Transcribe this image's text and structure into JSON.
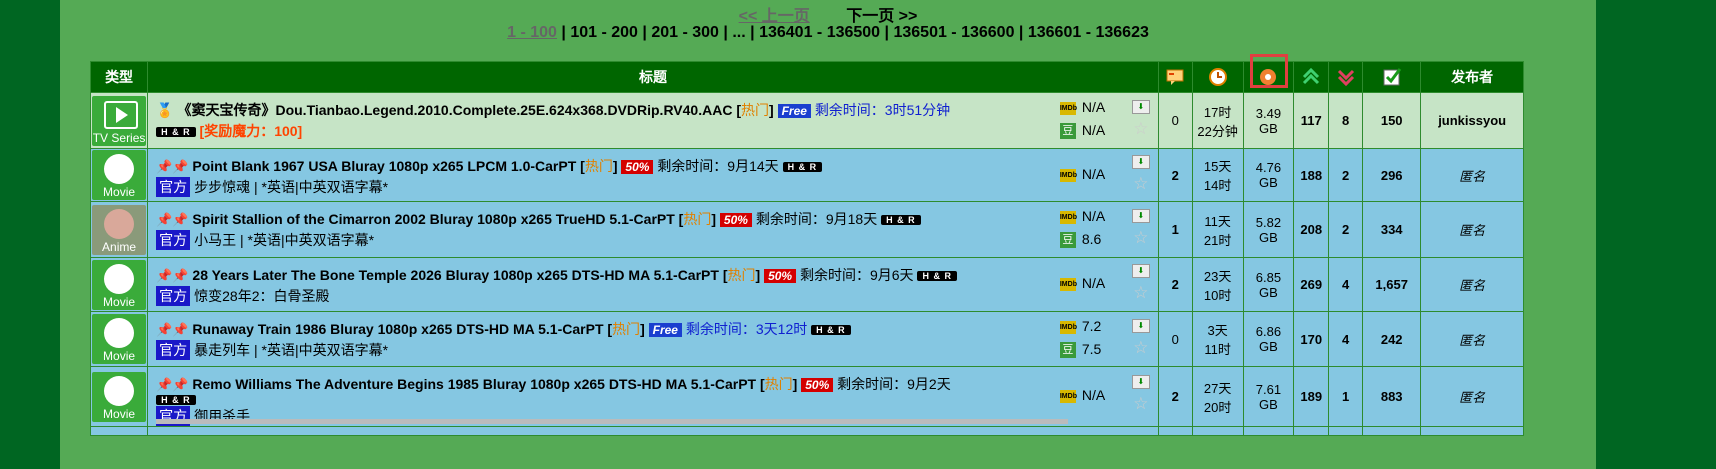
{
  "pager": {
    "prev": "<< 上一页",
    "next": "下一页 >>",
    "ranges": [
      "1 - 100",
      "101 - 200",
      "201 - 300",
      "...",
      "136401 - 136500",
      "136501 - 136600",
      "136601 - 136623"
    ],
    "sep": "|"
  },
  "headers": {
    "type": "类型",
    "title": "标题",
    "uploader": "发布者"
  },
  "rows": [
    {
      "category": "TV Series",
      "title": "《窦天宝传奇》Dou.Tianbao.Legend.2010.Complete.25E.624x368.DVDRip.RV40.AAC",
      "hot": "热门",
      "promo": "Free",
      "remaining": "剩余时间：3时51分钟",
      "tag": "H & R",
      "bonus": "[奖励魔力：100]",
      "imdb": "N/A",
      "douban": "N/A",
      "comments": "0",
      "time1": "17时",
      "time2": "22分钟",
      "size1": "3.49",
      "size2": "GB",
      "seeders": "117",
      "leechers": "8",
      "completed": "150",
      "uploader": "junkissyou"
    },
    {
      "category": "Movie",
      "title": "Point Blank 1967 USA Bluray 1080p x265 LPCM 1.0-CarPT",
      "hot": "热门",
      "promo": "50%",
      "remaining": "剩余时间：9月14天",
      "tag": "H & R",
      "official": "官方",
      "subtitle": "步步惊魂 | *英语|中英双语字幕*",
      "imdb": "N/A",
      "comments": "2",
      "time1": "15天",
      "time2": "14时",
      "size1": "4.76",
      "size2": "GB",
      "seeders": "188",
      "leechers": "2",
      "completed": "296",
      "uploader": "匿名"
    },
    {
      "category": "Anime",
      "title": "Spirit Stallion of the Cimarron 2002 Bluray 1080p x265 TrueHD 5.1-CarPT",
      "hot": "热门",
      "promo": "50%",
      "remaining": "剩余时间：9月18天",
      "tag": "H & R",
      "official": "官方",
      "subtitle": "小马王 | *英语|中英双语字幕*",
      "imdb": "N/A",
      "douban": "8.6",
      "comments": "1",
      "time1": "11天",
      "time2": "21时",
      "size1": "5.82",
      "size2": "GB",
      "seeders": "208",
      "leechers": "2",
      "completed": "334",
      "uploader": "匿名"
    },
    {
      "category": "Movie",
      "title": "28 Years Later The Bone Temple 2026 Bluray 1080p x265 DTS-HD MA 5.1-CarPT",
      "hot": "热门",
      "promo": "50%",
      "remaining": "剩余时间：9月6天",
      "tag": "H & R",
      "official": "官方",
      "subtitle": "惊变28年2：白骨圣殿",
      "imdb": "N/A",
      "comments": "2",
      "time1": "23天",
      "time2": "10时",
      "size1": "6.85",
      "size2": "GB",
      "seeders": "269",
      "leechers": "4",
      "completed": "1,657",
      "uploader": "匿名"
    },
    {
      "category": "Movie",
      "title": "Runaway Train 1986 Bluray 1080p x265 DTS-HD MA 5.1-CarPT",
      "hot": "热门",
      "promo": "Free",
      "remaining": "剩余时间：3天12时",
      "tag": "H & R",
      "official": "官方",
      "subtitle": "暴走列车 | *英语|中英双语字幕*",
      "imdb": "7.2",
      "douban": "7.5",
      "comments": "0",
      "time1": "3天",
      "time2": "11时",
      "size1": "6.86",
      "size2": "GB",
      "seeders": "170",
      "leechers": "4",
      "completed": "242",
      "uploader": "匿名"
    },
    {
      "category": "Movie",
      "title": "Remo Williams The Adventure Begins 1985 Bluray 1080p x265 DTS-HD MA 5.1-CarPT",
      "hot": "热门",
      "promo": "50%",
      "remaining": "剩余时间：9月2天",
      "tag": "H & R",
      "official": "官方",
      "subtitle": "御用杀手",
      "imdb": "N/A",
      "comments": "2",
      "time1": "27天",
      "time2": "20时",
      "size1": "7.61",
      "size2": "GB",
      "seeders": "189",
      "leechers": "1",
      "completed": "883",
      "uploader": "匿名"
    }
  ],
  "icons": {
    "comments": "comment-icon",
    "time": "clock-icon",
    "size": "disc-icon",
    "seeders": "up-arrow-icon",
    "leechers": "down-arrow-icon",
    "completed": "check-icon"
  },
  "colors": {
    "page_bg": "#006622",
    "panel_bg": "#55aa55",
    "header_bg": "#006600",
    "row_first": "#c6e4c6",
    "row": "#85c7e2",
    "highlight": "#e04040"
  }
}
